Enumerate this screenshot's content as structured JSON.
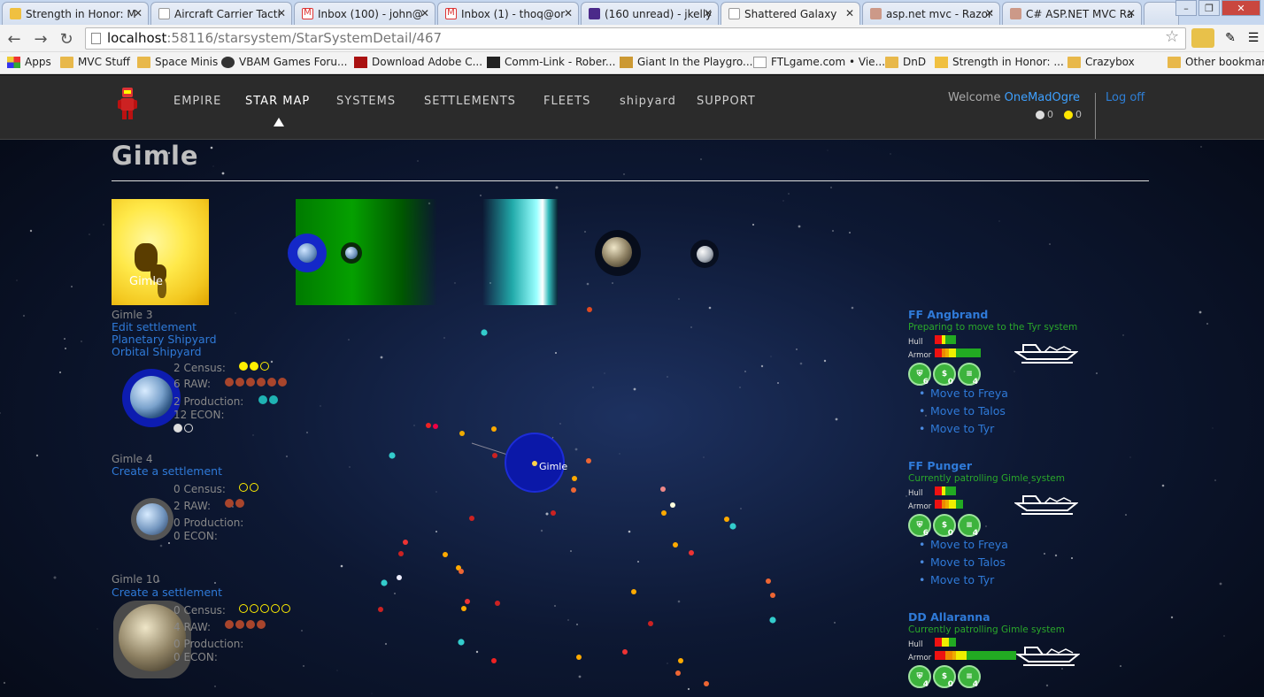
{
  "browser": {
    "tabs": [
      {
        "label": "Strength in Honor: M"
      },
      {
        "label": "Aircraft Carrier Tacti"
      },
      {
        "label": "Inbox (100) - john@"
      },
      {
        "label": "Inbox (1) - thoq@or"
      },
      {
        "label": "(160 unread) - jkelly"
      },
      {
        "label": "Shattered Galaxy"
      },
      {
        "label": "asp.net mvc - Razor"
      },
      {
        "label": "C# ASP.NET MVC Ra"
      }
    ],
    "url_host": "localhost",
    "url_path": ":58116/starsystem/StarSystemDetail/467",
    "bookmarks": [
      {
        "label": "Apps"
      },
      {
        "label": "MVC Stuff"
      },
      {
        "label": "Space Minis"
      },
      {
        "label": "VBAM Games Foru..."
      },
      {
        "label": "Download Adobe C..."
      },
      {
        "label": "Comm-Link - Rober..."
      },
      {
        "label": "Giant In the Playgro..."
      },
      {
        "label": "FTLgame.com • Vie..."
      },
      {
        "label": "DnD"
      },
      {
        "label": "Strength in Honor: ..."
      },
      {
        "label": "Crazybox"
      },
      {
        "label": "Other bookmarks"
      }
    ]
  },
  "site": {
    "nav": [
      {
        "label": "EMPIRE"
      },
      {
        "label": "STAR MAP"
      },
      {
        "label": "SYSTEMS"
      },
      {
        "label": "SETTLEMENTS"
      },
      {
        "label": "FLEETS"
      },
      {
        "label": "shipyard"
      },
      {
        "label": "SUPPORT"
      }
    ],
    "welcome": "Welcome",
    "username": "OneMadOgre",
    "logoff": "Log off",
    "res1": "0",
    "res2": "0"
  },
  "system": {
    "name": "Gimle",
    "star_label": "Gimle",
    "map_label": "Gimle"
  },
  "planets": [
    {
      "name": "Gimle 3",
      "links": [
        "Edit settlement",
        "Planetary Shipyard",
        "Orbital Shipyard"
      ],
      "census": "2 Census:",
      "raw": "6 RAW:",
      "production": "2 Production:",
      "econ": "12 ECON:"
    },
    {
      "name": "Gimle 4",
      "links": [
        "Create a settlement"
      ],
      "census": "0 Census:",
      "raw": "2 RAW:",
      "production": "0 Production:",
      "econ": "0 ECON:"
    },
    {
      "name": "Gimle 10",
      "links": [
        "Create a settlement"
      ],
      "census": "0 Census:",
      "raw": "4 RAW:",
      "production": "0 Production:",
      "econ": "0 ECON:"
    }
  ],
  "fleets": [
    {
      "name": "FF Angbrand",
      "status": "Preparing to move to the Tyr system",
      "hull": "Hull",
      "armor": "Armor",
      "counts": [
        "6",
        "0",
        "4"
      ],
      "moves": [
        "Move to Freya",
        "Move to Talos",
        "Move to Tyr"
      ]
    },
    {
      "name": "FF Punger",
      "status": "Currently patrolling Gimle system",
      "hull": "Hull",
      "armor": "Armor",
      "counts": [
        "6",
        "0",
        "4"
      ],
      "moves": [
        "Move to Freya",
        "Move to Talos",
        "Move to Tyr"
      ]
    },
    {
      "name": "DD Allaranna",
      "status": "Currently patrolling Gimle system",
      "hull": "Hull",
      "armor": "Armor",
      "counts": [
        "4",
        "0",
        "4"
      ],
      "moves": []
    }
  ],
  "colors": {
    "link": "#2f7ad8",
    "status_green": "#2aa82a",
    "username": "#3ea0ff"
  }
}
